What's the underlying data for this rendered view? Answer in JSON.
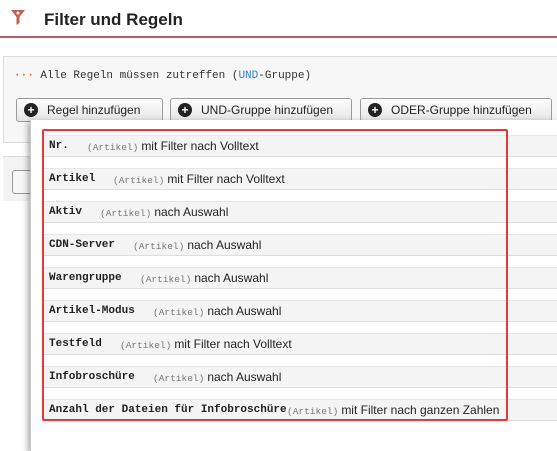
{
  "header": {
    "title": "Filter und Regeln",
    "icon": "funnel-icon",
    "accent": "#b06060"
  },
  "group": {
    "dots": "···",
    "prefix": " Alle Regeln müssen zutreffen (",
    "und": "UND",
    "suffix": "-Gruppe)"
  },
  "buttons": [
    {
      "label": "Regel hinzufügen"
    },
    {
      "label": "UND-Gruppe hinzufügen"
    },
    {
      "label": "ODER-Gruppe hinzufügen"
    }
  ],
  "items": [
    {
      "name": "Nr.",
      "tag": "(Artikel)",
      "desc": "mit Filter nach Volltext"
    },
    {
      "name": "Artikel",
      "tag": "(Artikel)",
      "desc": "mit Filter nach Volltext"
    },
    {
      "name": "Aktiv",
      "tag": "(Artikel)",
      "desc": "nach Auswahl"
    },
    {
      "name": "CDN-Server",
      "tag": "(Artikel)",
      "desc": "nach Auswahl"
    },
    {
      "name": "Warengruppe",
      "tag": "(Artikel)",
      "desc": "nach Auswahl"
    },
    {
      "name": "Artikel-Modus",
      "tag": "(Artikel)",
      "desc": "nach Auswahl"
    },
    {
      "name": "Testfeld",
      "tag": "(Artikel)",
      "desc": "mit Filter nach Volltext"
    },
    {
      "name": "Infobroschüre",
      "tag": "(Artikel)",
      "desc": "nach Auswahl"
    },
    {
      "name": "Anzahl der Dateien für Infobroschüre",
      "tag": "(Artikel)",
      "desc": "mit Filter nach ganzen Zahlen"
    }
  ],
  "highlight_color": "#e53935"
}
